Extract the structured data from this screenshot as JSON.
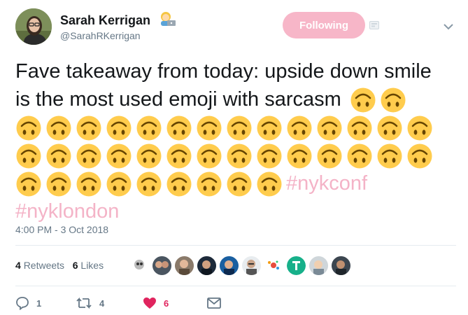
{
  "tweet": {
    "author_name": "Sarah Kerrigan",
    "author_handle": "@SarahRKerrigan",
    "follow_label": "Following",
    "text_lines": [
      "Fave takeaway from today: upside down smile",
      "is the most used emoji with sarcasm"
    ],
    "hashtags": [
      "#nykconf",
      "#nyklondon"
    ],
    "timestamp": "4:00 PM - 3 Oct 2018",
    "retweets_count": "4",
    "retweets_label": "Retweets",
    "likes_count": "6",
    "likes_label": "Likes",
    "replies": "1",
    "retweets_action": "4",
    "likes_action": "6"
  },
  "colors": {
    "follow_button": "#f7b6c8",
    "hashtag": "#f4b3c7",
    "like_heart": "#e0245e",
    "muted": "#657786"
  },
  "icons": {
    "name_emoji": "woman-technologist-emoji",
    "upside_down_face": "upside-down-face-emoji",
    "reply": "reply-icon",
    "retweet": "retweet-icon",
    "like": "heart-icon",
    "dm": "envelope-icon",
    "caret": "chevron-down-icon"
  },
  "emoji_counts": {
    "line2": 2,
    "line3": 14,
    "line4": 14,
    "line5": 9
  }
}
